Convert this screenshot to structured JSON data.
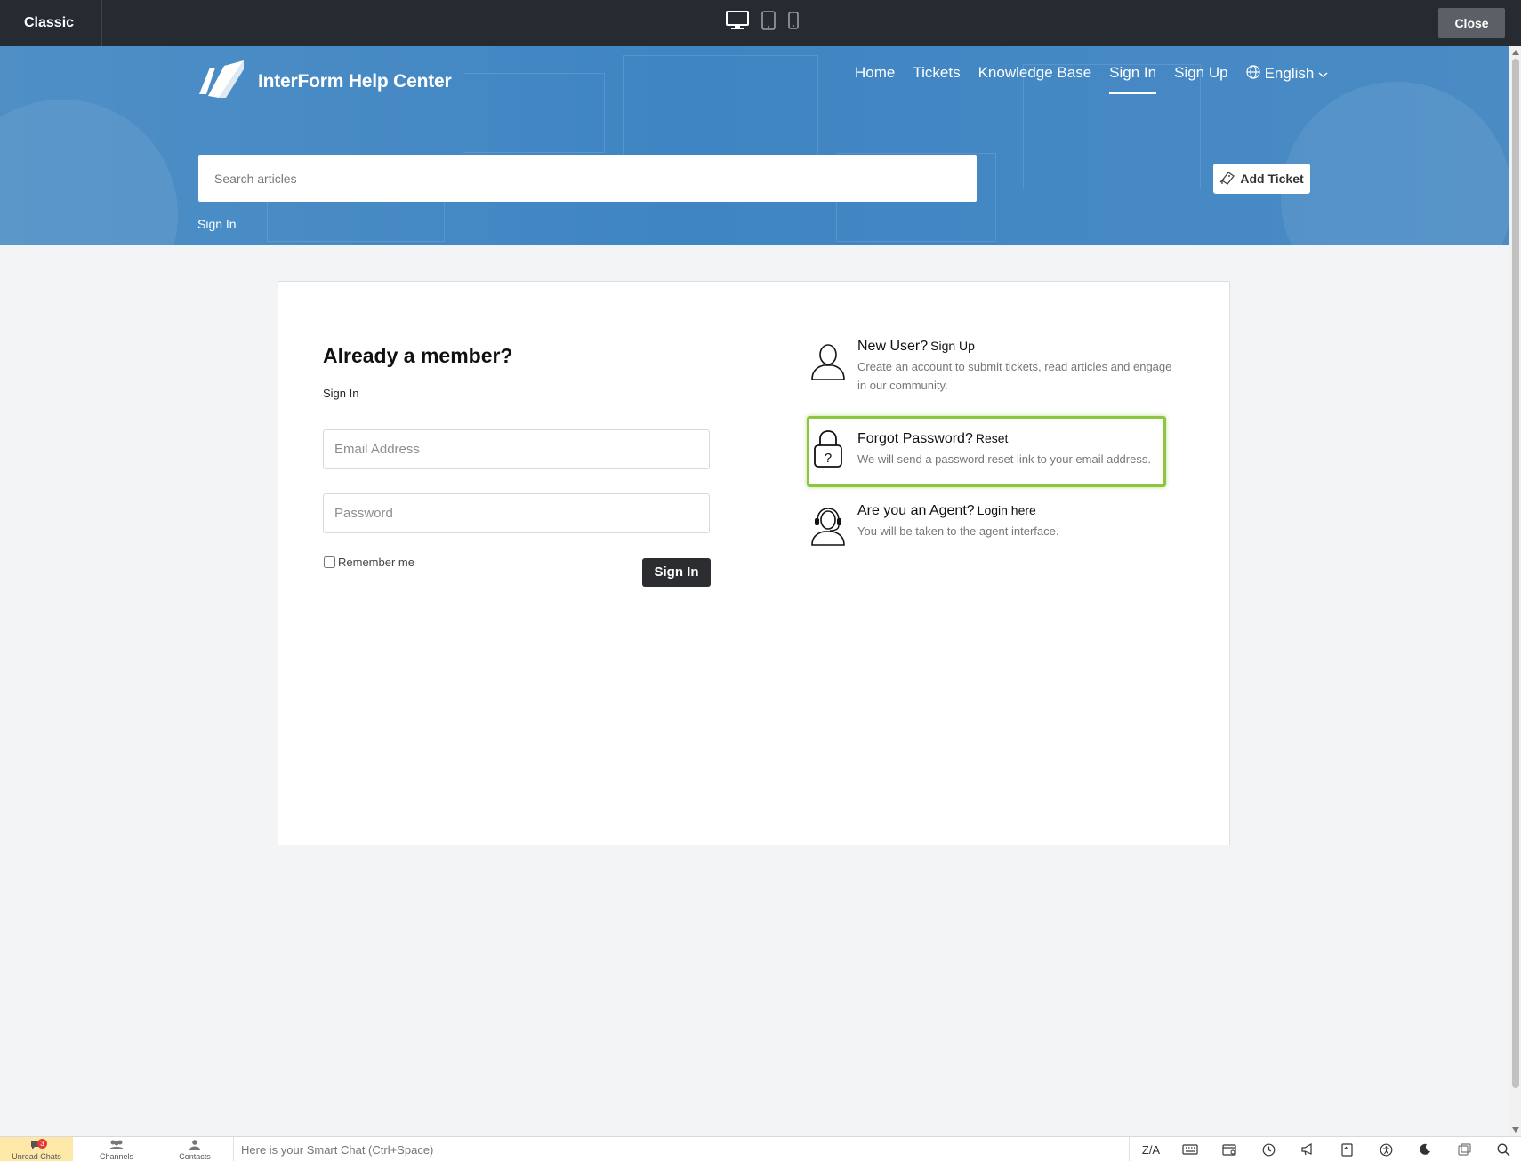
{
  "preview": {
    "mode_label": "Classic",
    "close_label": "Close",
    "devices": [
      "desktop-icon",
      "tablet-icon",
      "mobile-icon"
    ]
  },
  "header": {
    "brand_name": "InterForm Help Center",
    "nav": [
      {
        "label": "Home"
      },
      {
        "label": "Tickets"
      },
      {
        "label": "Knowledge Base"
      },
      {
        "label": "Sign In",
        "active": true
      },
      {
        "label": "Sign Up"
      }
    ],
    "language": "English",
    "search_placeholder": "Search articles",
    "add_ticket_label": "Add Ticket",
    "breadcrumb": "Sign In"
  },
  "login": {
    "title": "Already a member?",
    "subtitle": "Sign In",
    "email_placeholder": "Email Address",
    "password_placeholder": "Password",
    "remember_label": "Remember me",
    "submit_label": "Sign In"
  },
  "options": {
    "new_user": {
      "heading": "New User?",
      "link": "Sign Up",
      "desc": "Create an account to submit tickets, read articles and engage in our community."
    },
    "forgot": {
      "heading": "Forgot Password?",
      "link": "Reset",
      "desc": "We will send a password reset link to your email address."
    },
    "agent": {
      "heading": "Are you an Agent?",
      "link": "Login here",
      "desc": "You will be taken to the agent interface."
    }
  },
  "bottom_bar": {
    "tabs": [
      {
        "label": "Unread Chats",
        "badge": "3"
      },
      {
        "label": "Channels"
      },
      {
        "label": "Contacts"
      }
    ],
    "smartchat_placeholder": "Here is your Smart Chat (Ctrl+Space)",
    "za_label": "Z/A"
  },
  "colors": {
    "hero_blue": "#3f85c3",
    "highlight_green": "#8cc640",
    "dark_button": "#2b2d31",
    "topbar": "#262a31"
  }
}
